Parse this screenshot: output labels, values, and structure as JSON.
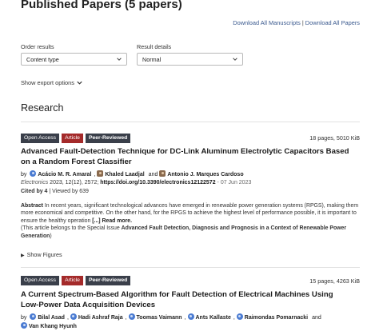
{
  "header": {
    "title": "Published Papers (5 papers)",
    "download_manuscripts": "Download All Manuscripts",
    "download_separator": "|",
    "download_papers": "Download All Papers"
  },
  "filters": {
    "order_label": "Order results",
    "order_value": "Content type",
    "detail_label": "Result details",
    "detail_value": "Normal",
    "export_label": "Show export options"
  },
  "section": {
    "title": "Research"
  },
  "papers": [
    {
      "badges": [
        "Open Access",
        "Article",
        "Peer-Reviewed"
      ],
      "meta": "18 pages, 5010 KiB",
      "title_line1": "Advanced Fault-Detection Technique for DC-Link Aluminum Electrolytic Capacitors Based",
      "title_line2": "on a Random Forest Classifier",
      "by": "by",
      "authors": [
        "Acácio M. R. Amaral",
        "Khaled Laadjal",
        "Antonio J. Marques Cardoso"
      ],
      "authors_sep": "and",
      "journal": "Electronics",
      "journal_rest": " 2023, 12(12), 2572;",
      "doi": "https://doi.org/10.3390/electronics12122572",
      "date": " - 07 Jun 2023",
      "cited": "Cited by 4",
      "viewed": " | Viewed by 639",
      "abstract_label": "Abstract",
      "abstract_text": " In recent years, significant technological advances have emerged in renewable power generation systems (RPGS), making them more economical and competitive. On the other hand, for the RPGS to achieve the highest level of performance possible, it is important to ensure the healthy operation ",
      "read_more": "[...] Read more.",
      "special_prefix": "(This article belongs to the Special Issue ",
      "special_issue": "Advanced Fault Detection, Diagnosis and Prognosis in a Context of Renewable Power Generation",
      "special_suffix": ")",
      "show_figures": "Show Figures"
    },
    {
      "badges": [
        "Open Access",
        "Article",
        "Peer-Reviewed"
      ],
      "meta": "15 pages, 4263 KiB",
      "title_line1": "A Current Spectrum-Based Algorithm for Fault Detection of Electrical Machines Using",
      "title_line2": "Low-Power Data Acquisition Devices",
      "by": "by",
      "authors": [
        "Bilal Asad",
        "Hadi Ashraf Raja",
        "Toomas Vaimann",
        "Ants Kallaste",
        "Raimondas Pomarnacki",
        "Van Khang Hyunh"
      ],
      "authors_sep": "and"
    }
  ],
  "colors": {
    "badge_dark": "#3a3f4a",
    "badge_article": "#a42a2a",
    "link": "#3b5a8f",
    "author_icon": "#4a7bd2"
  }
}
